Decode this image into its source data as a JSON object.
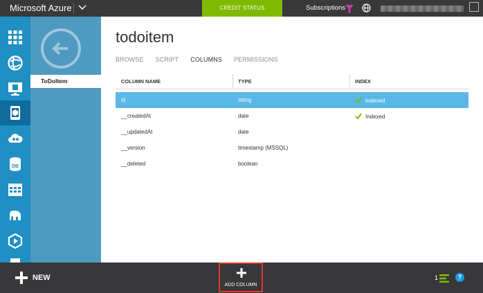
{
  "topbar": {
    "brand": "Microsoft Azure",
    "credit_status": "CREDIT STATUS",
    "subscriptions": "Subscriptions"
  },
  "rail": {
    "icons": [
      "all-items-icon",
      "web-sites-icon",
      "virtual-machines-icon",
      "mobile-services-icon",
      "cloud-services-icon",
      "sql-databases-icon",
      "storage-icon",
      "hdinsight-icon",
      "media-services-icon",
      "service-bus-icon"
    ]
  },
  "panel": {
    "item": "ToDoItem"
  },
  "main": {
    "title": "todoitem",
    "tabs": [
      "BROWSE",
      "SCRIPT",
      "COLUMNS",
      "PERMISSIONS"
    ],
    "active_tab": "COLUMNS",
    "headers": [
      "COLUMN NAME",
      "TYPE",
      "INDEX"
    ],
    "rows": [
      {
        "name": "id",
        "type": "string",
        "index": "Indexed"
      },
      {
        "name": "__createdAt",
        "type": "date",
        "index": "Indexed"
      },
      {
        "name": "__updatedAt",
        "type": "date",
        "index": ""
      },
      {
        "name": "__version",
        "type": "timestamp (MSSQL)",
        "index": ""
      },
      {
        "name": "__deleted",
        "type": "boolean",
        "index": ""
      }
    ]
  },
  "bottombar": {
    "new_label": "NEW",
    "add_column_label": "ADD COLUMN",
    "count": "1",
    "help": "?"
  },
  "colors": {
    "topbar": "#39393a",
    "credit_green": "#7fba00",
    "rail_blue": "#1f8fc4",
    "panel_blue": "#4f9ac1",
    "selected_row": "#5ab8e6",
    "check_green": "#7fba00",
    "highlight_red": "#e0342a"
  }
}
